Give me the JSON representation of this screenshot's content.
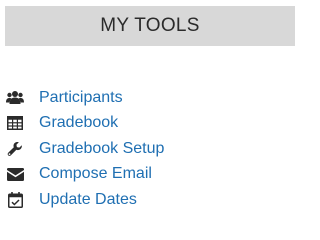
{
  "header": {
    "title": "MY TOOLS"
  },
  "menu": {
    "items": [
      {
        "label": "Participants",
        "icon": "users-icon"
      },
      {
        "label": "Gradebook",
        "icon": "table-icon"
      },
      {
        "label": "Gradebook Setup",
        "icon": "wrench-icon"
      },
      {
        "label": "Compose Email",
        "icon": "envelope-icon"
      },
      {
        "label": "Update Dates",
        "icon": "calendar-check-icon"
      }
    ]
  },
  "colors": {
    "link": "#1f6fb2",
    "header_bg": "#d8d8d8",
    "icon": "#2b2b2b"
  }
}
